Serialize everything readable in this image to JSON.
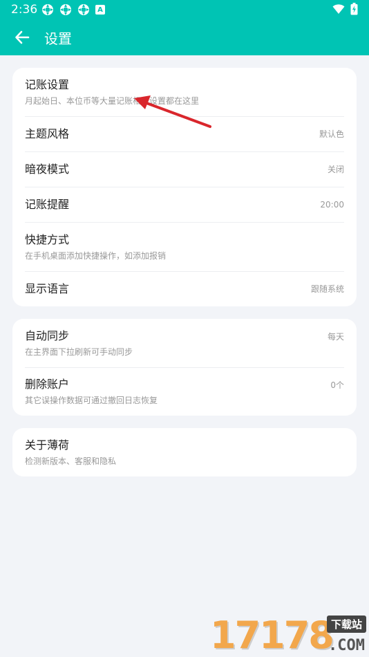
{
  "status_bar": {
    "time": "2:36",
    "indicator_letter": "A"
  },
  "header": {
    "title": "设置"
  },
  "card1": {
    "items": [
      {
        "title": "记账设置",
        "subtitle": "月起始日、本位币等大量记账相关设置都在这里",
        "value": ""
      },
      {
        "title": "主题风格",
        "subtitle": "",
        "value": "默认色"
      },
      {
        "title": "暗夜模式",
        "subtitle": "",
        "value": "关闭"
      },
      {
        "title": "记账提醒",
        "subtitle": "",
        "value": "20:00"
      },
      {
        "title": "快捷方式",
        "subtitle": "在手机桌面添加快捷操作，如添加报销",
        "value": ""
      },
      {
        "title": "显示语言",
        "subtitle": "",
        "value": "跟随系统"
      }
    ]
  },
  "card2": {
    "items": [
      {
        "title": "自动同步",
        "subtitle": "在主界面下拉刷新可手动同步",
        "value": "每天"
      },
      {
        "title": "删除账户",
        "subtitle": "其它误操作数据可通过撤回日志恢复",
        "value": "0个"
      }
    ]
  },
  "card3": {
    "items": [
      {
        "title": "关于薄荷",
        "subtitle": "检测新版本、客服和隐私",
        "value": ""
      }
    ]
  },
  "watermark": {
    "digits": "17178",
    "tag": "下载站",
    "suffix": ".COM"
  },
  "colors": {
    "primary": "#00c4b4",
    "background": "#f2f4f8",
    "annotation_arrow": "#d9262c"
  }
}
